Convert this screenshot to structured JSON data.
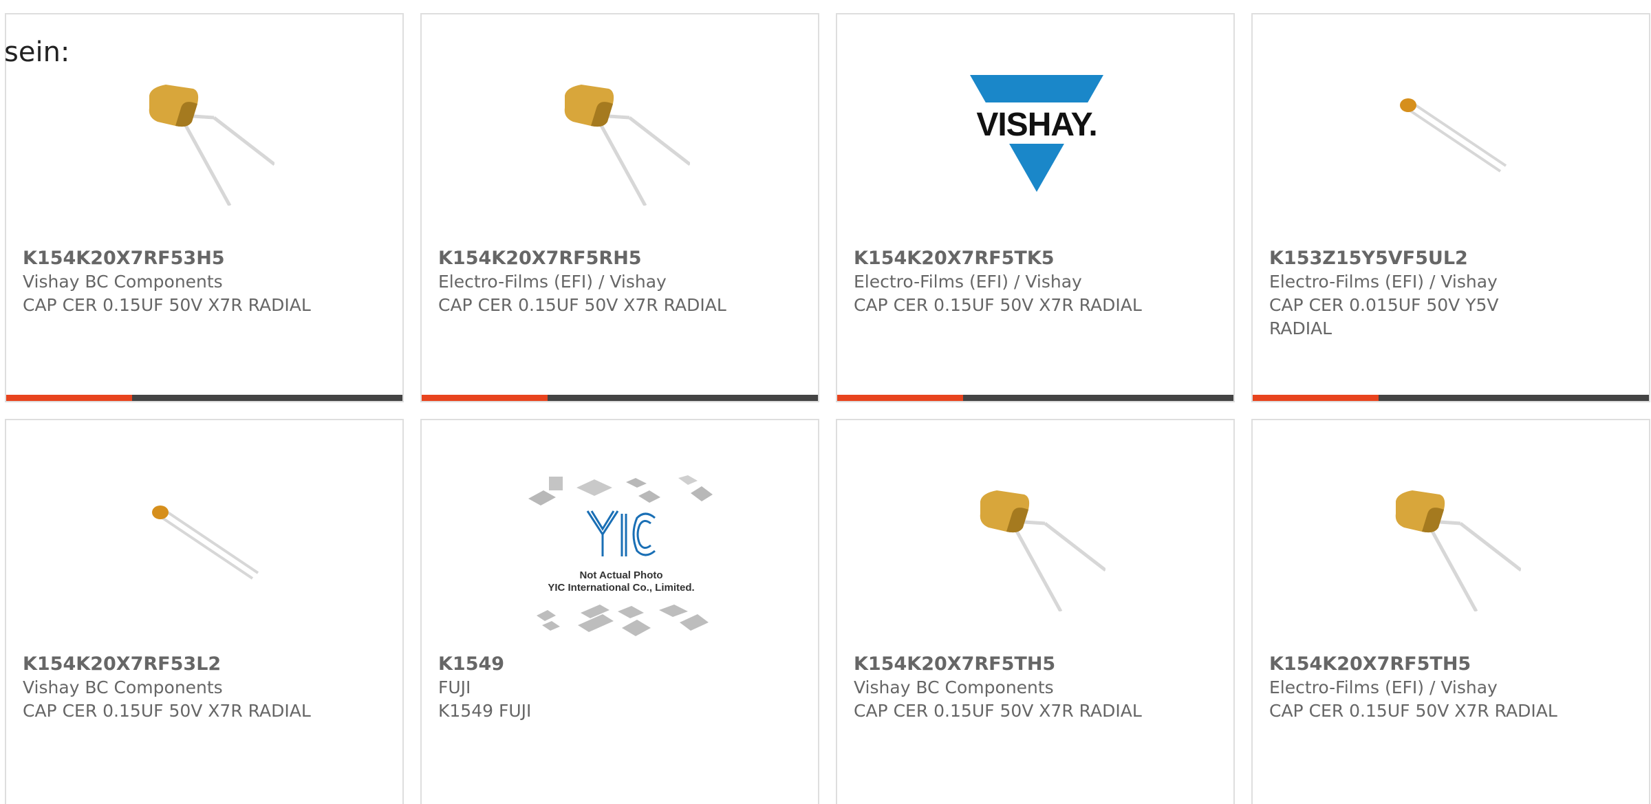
{
  "leading_text": "sein:",
  "colors": {
    "card_border": "#dedede",
    "text": "#666666",
    "bar_base": "#444444",
    "bar_accent": "#e8441e",
    "capacitor_body": "#d8a63b",
    "vishay_blue": "#1a87c9"
  },
  "cards": [
    {
      "part_number": "K154K20X7RF53H5",
      "manufacturer": "Vishay BC Components",
      "description": "CAP CER 0.15UF 50V X7R RADIAL",
      "image": "radial-capacitor-icon"
    },
    {
      "part_number": "K154K20X7RF5RH5",
      "manufacturer": "Electro-Films (EFI) / Vishay",
      "description": "CAP CER 0.15UF 50V X7R RADIAL",
      "image": "radial-capacitor-icon"
    },
    {
      "part_number": "K154K20X7RF5TK5",
      "manufacturer": "Electro-Films (EFI) / Vishay",
      "description": "CAP CER 0.15UF 50V X7R RADIAL",
      "image": "vishay-logo",
      "logo_text": "VISHAY."
    },
    {
      "part_number": "K153Z15Y5VF5UL2",
      "manufacturer": "Electro-Films (EFI) / Vishay",
      "description": "CAP CER 0.015UF 50V Y5V RADIAL",
      "image": "small-capacitor-icon"
    },
    {
      "part_number": "K154K20X7RF53L2",
      "manufacturer": "Vishay BC Components",
      "description": "CAP CER 0.15UF 50V X7R RADIAL",
      "image": "small-capacitor-icon"
    },
    {
      "part_number": "K1549",
      "manufacturer": "FUJI",
      "description": "K1549 FUJI",
      "image": "yic-placeholder",
      "placeholder_line1": "Not Actual Photo",
      "placeholder_line2": "YIC International Co., Limited."
    },
    {
      "part_number": "K154K20X7RF5TH5",
      "manufacturer": "Vishay BC Components",
      "description": "CAP CER 0.15UF 50V X7R RADIAL",
      "image": "radial-capacitor-icon"
    },
    {
      "part_number": "K154K20X7RF5TH5",
      "manufacturer": "Electro-Films (EFI) / Vishay",
      "description": "CAP CER 0.15UF 50V X7R RADIAL",
      "image": "radial-capacitor-icon"
    }
  ]
}
